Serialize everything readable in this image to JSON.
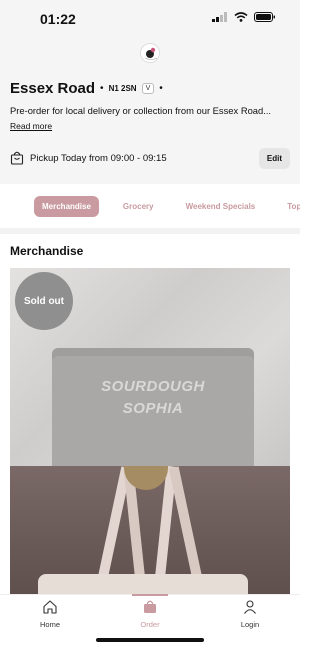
{
  "status_bar": {
    "time": "01:22"
  },
  "store": {
    "name": "Essex Road",
    "postcode": "N1 2SN",
    "badge": "V",
    "description": "Pre-order for local delivery or collection from our Essex Road...",
    "read_more": "Read more",
    "pickup_text": "Pickup Today from 09:00 - 09:15",
    "edit_label": "Edit"
  },
  "categories": {
    "tabs": [
      "Merchandise",
      "Grocery",
      "Weekend Specials",
      "Toppe"
    ],
    "active": "Merchandise"
  },
  "section": {
    "title": "Merchandise"
  },
  "product": {
    "sold_out_label": "Sold out",
    "bag_text_line1": "SOURDOUGH",
    "bag_text_line2": "SOPHIA"
  },
  "bottom_nav": {
    "items": [
      {
        "label": "Home",
        "icon": "home-icon"
      },
      {
        "label": "Order",
        "icon": "bag-icon"
      },
      {
        "label": "Login",
        "icon": "user-icon"
      }
    ]
  },
  "colors": {
    "accent": "#c99a9f"
  }
}
